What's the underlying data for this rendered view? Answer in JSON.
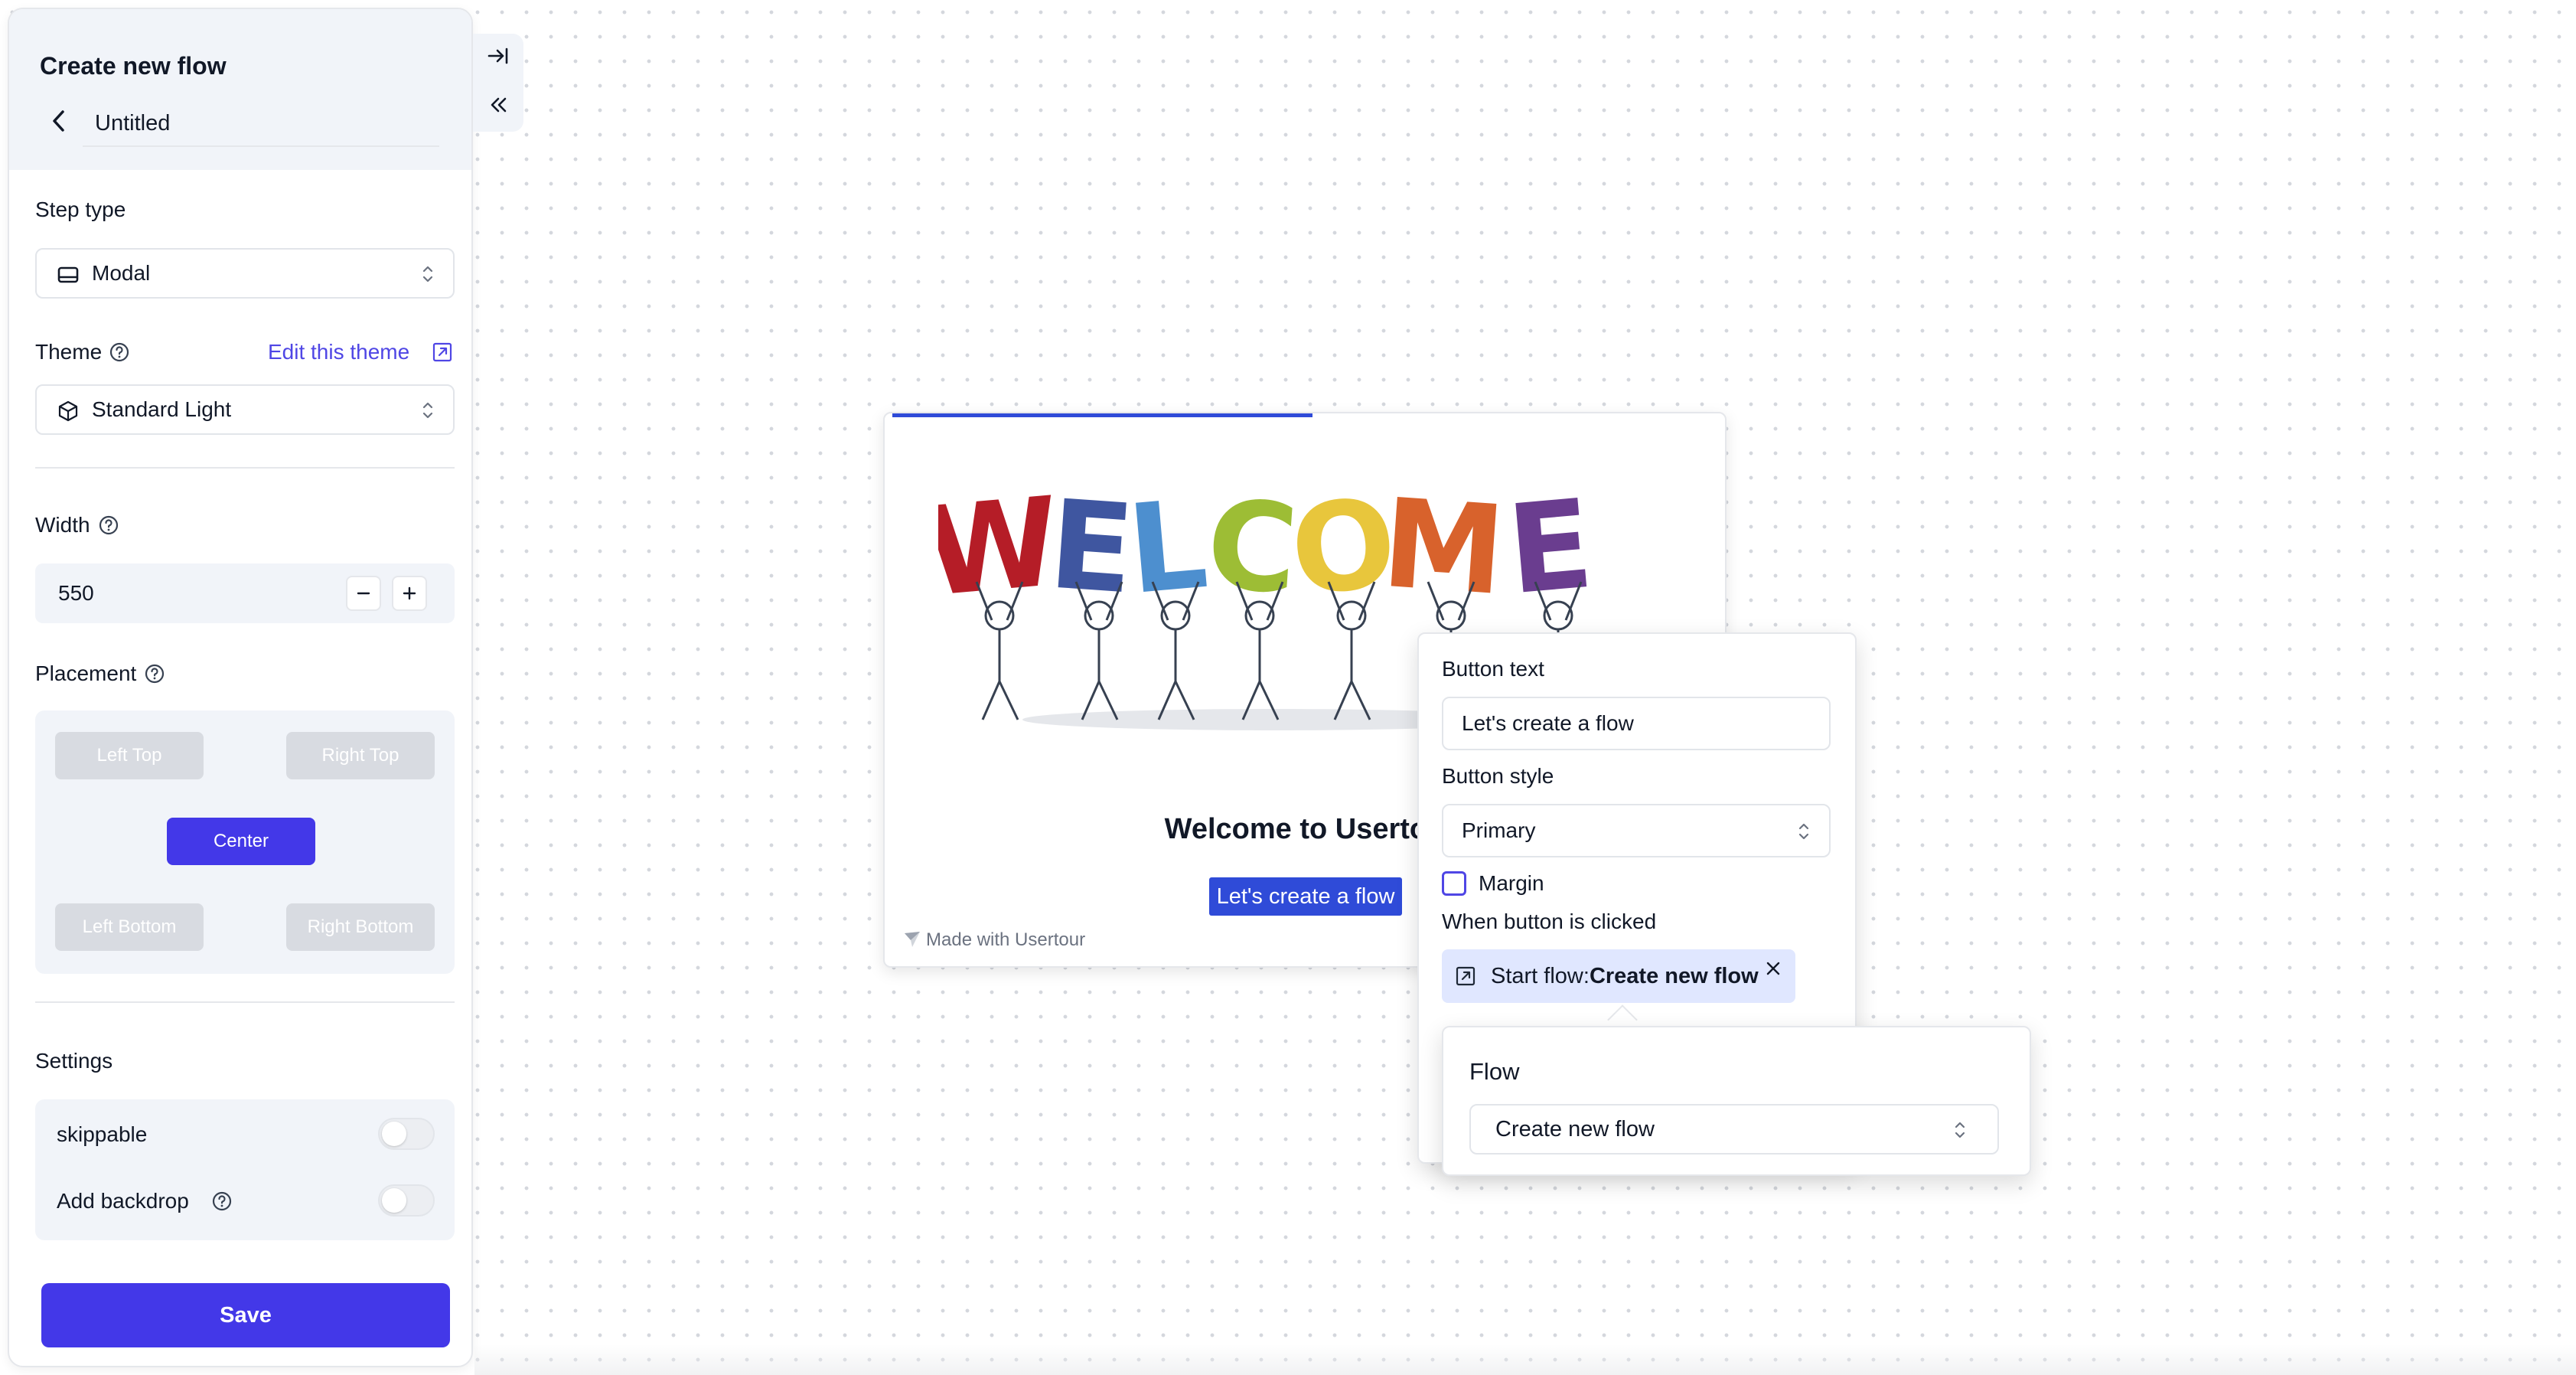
{
  "sidebar": {
    "title": "Create new flow",
    "step_name": "Untitled",
    "step_type_label": "Step type",
    "step_type_value": "Modal",
    "theme_label": "Theme",
    "edit_theme_link": "Edit this theme",
    "theme_value": "Standard Light",
    "width_label": "Width",
    "width_value": "550",
    "placement_label": "Placement",
    "placement_options": {
      "left_top": "Left Top",
      "right_top": "Right Top",
      "center": "Center",
      "left_bottom": "Left Bottom",
      "right_bottom": "Right Bottom"
    },
    "placement_selected": "Center",
    "settings_label": "Settings",
    "settings": {
      "skippable": {
        "label": "skippable",
        "on": false
      },
      "backdrop": {
        "label": "Add backdrop",
        "on": false
      }
    },
    "save_label": "Save"
  },
  "modal": {
    "art_letters": [
      "W",
      "E",
      "L",
      "C",
      "O",
      "M",
      "E"
    ],
    "art_colors": [
      "#b51d27",
      "#3f56a0",
      "#4d8fcf",
      "#9dbd35",
      "#e8c63c",
      "#d8622c",
      "#6a3d8f"
    ],
    "heading": "Welcome to Usertou",
    "cta": "Let's create a flow",
    "made_with": "Made with Usertour",
    "progress_fraction": 0.5
  },
  "button_settings": {
    "text_label": "Button text",
    "text_value": "Let's create a flow",
    "style_label": "Button style",
    "style_value": "Primary",
    "margin_label": "Margin",
    "margin_checked": false,
    "on_click_label": "When button is clicked",
    "action_prefix": "Start flow:",
    "action_target": "Create new flow"
  },
  "flow_picker": {
    "label": "Flow",
    "value": "Create new flow"
  },
  "colors": {
    "accent": "#4338e8",
    "modal_primary": "#2f4bd8",
    "link": "#4f46e5"
  }
}
